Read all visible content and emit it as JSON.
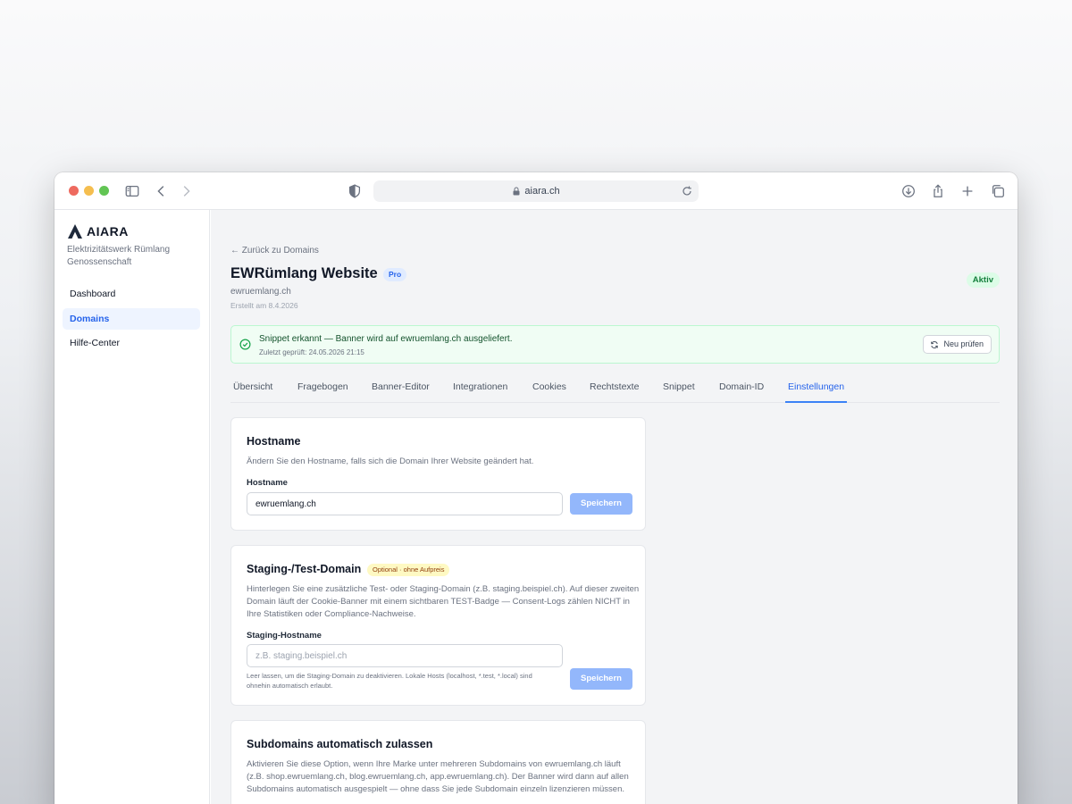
{
  "browser": {
    "url": "aiara.ch"
  },
  "sidebar": {
    "logo_text": "AIARA",
    "org_name": "Elektrizitätswerk Rümlang Genossenschaft",
    "items": [
      {
        "label": "Dashboard",
        "active": false
      },
      {
        "label": "Domains",
        "active": true
      },
      {
        "label": "Hilfe-Center",
        "active": false
      }
    ]
  },
  "header": {
    "back_link": "← Zurück zu Domains",
    "title": "EWRümlang Website",
    "plan_badge": "Pro",
    "hostname": "ewruemlang.ch",
    "created": "Erstellt am 8.4.2026",
    "status": "Aktiv"
  },
  "alert": {
    "title": "Snippet erkannt — Banner wird auf ewruemlang.ch ausgeliefert.",
    "subtitle": "Zuletzt geprüft: 24.05.2026 21:15",
    "button": "Neu prüfen"
  },
  "tabs": [
    {
      "label": "Übersicht"
    },
    {
      "label": "Fragebogen"
    },
    {
      "label": "Banner-Editor"
    },
    {
      "label": "Integrationen"
    },
    {
      "label": "Cookies"
    },
    {
      "label": "Rechtstexte"
    },
    {
      "label": "Snippet"
    },
    {
      "label": "Domain-ID"
    },
    {
      "label": "Einstellungen",
      "active": true
    }
  ],
  "hostname_card": {
    "title": "Hostname",
    "description": "Ändern Sie den Hostname, falls sich die Domain Ihrer Website geändert hat.",
    "field_label": "Hostname",
    "value": "ewruemlang.ch",
    "save": "Speichern"
  },
  "staging_card": {
    "title": "Staging-/Test-Domain",
    "badge": "Optional · ohne Aufpreis",
    "description": "Hinterlegen Sie eine zusätzliche Test- oder Staging-Domain (z.B. staging.beispiel.ch). Auf dieser zweiten Domain läuft der Cookie-Banner mit einem sichtbaren TEST-Badge — Consent-Logs zählen NICHT in Ihre Statistiken oder Compliance-Nachweise.",
    "field_label": "Staging-Hostname",
    "placeholder": "z.B. staging.beispiel.ch",
    "hint": "Leer lassen, um die Staging-Domain zu deaktivieren. Lokale Hosts (localhost, *.test, *.local) sind ohnehin automatisch erlaubt.",
    "save": "Speichern"
  },
  "subdomains_card": {
    "title": "Subdomains automatisch zulassen",
    "description": "Aktivieren Sie diese Option, wenn Ihre Marke unter mehreren Subdomains von ewruemlang.ch läuft (z.B. shop.ewruemlang.ch, blog.ewruemlang.ch, app.ewruemlang.ch). Der Banner wird dann auf allen Subdomains automatisch ausgespielt — ohne dass Sie jede Subdomain einzeln lizenzieren müssen."
  }
}
